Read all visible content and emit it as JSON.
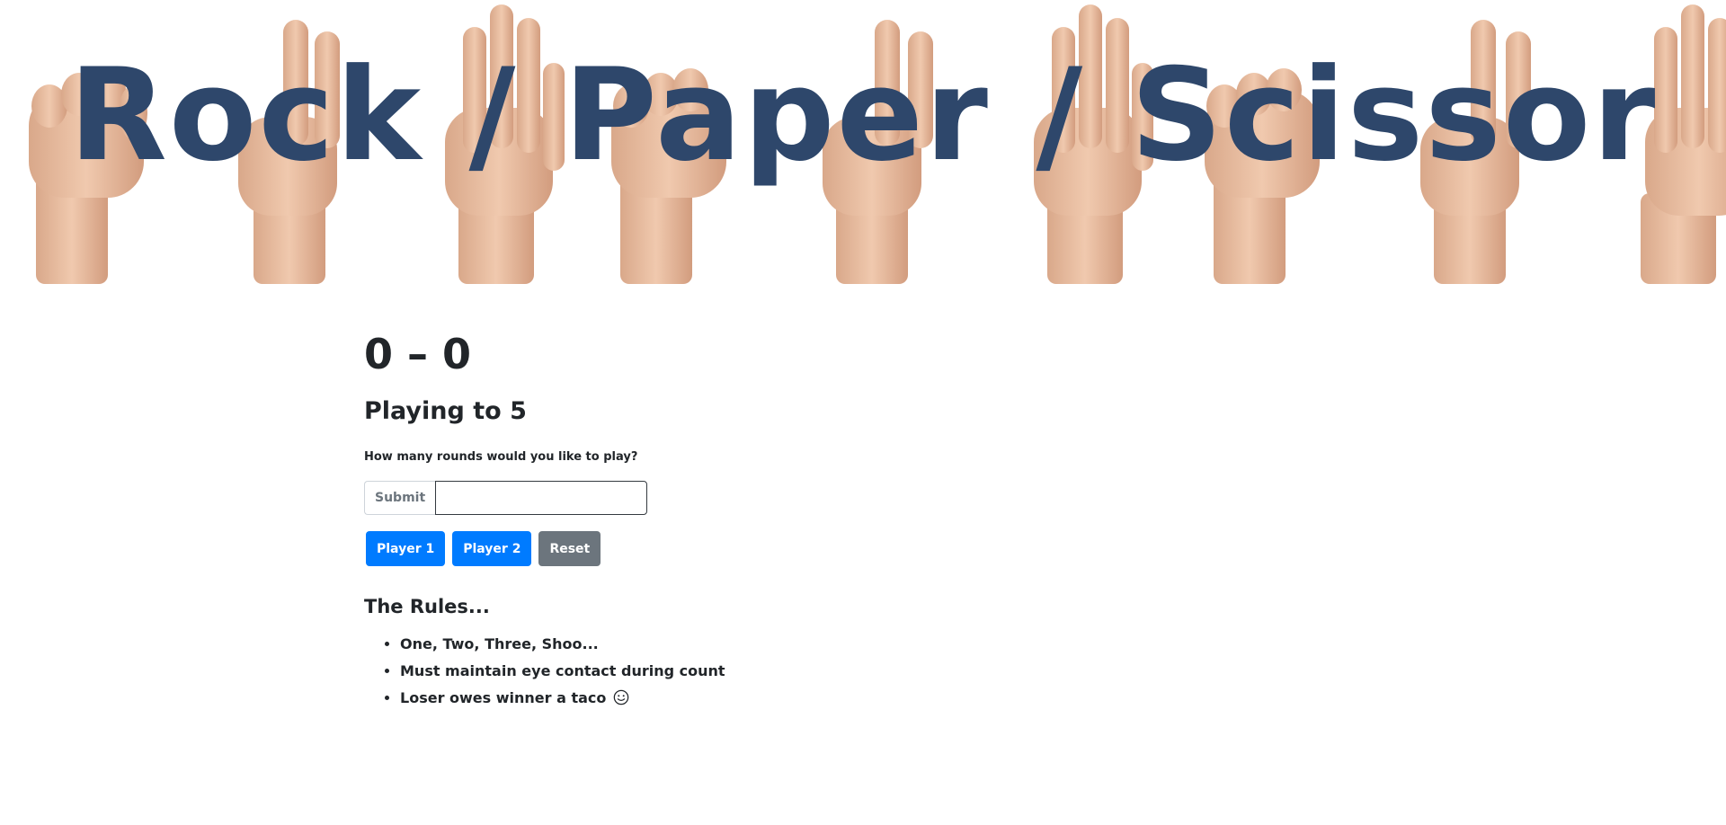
{
  "header": {
    "title": "Rock / Paper / Scissor",
    "title_color": "#2e476b",
    "background": "hand-gestures-image"
  },
  "scoreboard": {
    "score": "0 – 0",
    "playing_to": "Playing to 5"
  },
  "rounds_form": {
    "prompt": "How many rounds would you like to play?",
    "submit_label": "Submit",
    "input_value": "",
    "input_placeholder": ""
  },
  "controls": {
    "player1_label": "Player 1",
    "player2_label": "Player 2",
    "reset_label": "Reset",
    "primary_color": "#007bff",
    "secondary_color": "#6c757d"
  },
  "rules": {
    "heading": "The Rules...",
    "items": [
      {
        "text": "One, Two, Three, Shoo..."
      },
      {
        "text": "Must maintain eye contact during count"
      },
      {
        "text": "Loser owes winner a taco",
        "icon": "smiley-icon"
      }
    ]
  }
}
